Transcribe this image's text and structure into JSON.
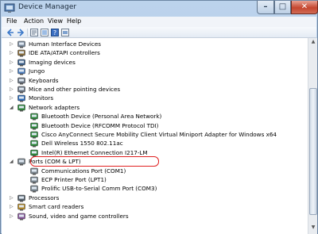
{
  "window": {
    "title": "Device Manager"
  },
  "menu": [
    "File",
    "Action",
    "View",
    "Help"
  ],
  "tree": [
    {
      "label": "Human Interface Devices",
      "expanded": false,
      "icon": "hid-icon"
    },
    {
      "label": "IDE ATA/ATAPI controllers",
      "expanded": false,
      "icon": "ide-icon"
    },
    {
      "label": "Imaging devices",
      "expanded": false,
      "icon": "camera-icon"
    },
    {
      "label": "Jungo",
      "expanded": false,
      "icon": "jungo-icon"
    },
    {
      "label": "Keyboards",
      "expanded": false,
      "icon": "keyboard-icon"
    },
    {
      "label": "Mice and other pointing devices",
      "expanded": false,
      "icon": "mouse-icon"
    },
    {
      "label": "Monitors",
      "expanded": false,
      "icon": "monitor-icon"
    },
    {
      "label": "Network adapters",
      "expanded": true,
      "icon": "network-icon"
    },
    {
      "label": "Bluetooth Device (Personal Area Network)",
      "child": true,
      "icon": "network-adapter-icon"
    },
    {
      "label": "Bluetooth Device (RFCOMM Protocol TDI)",
      "child": true,
      "icon": "network-adapter-icon"
    },
    {
      "label": "Cisco AnyConnect Secure Mobility Client Virtual Miniport Adapter for Windows x64",
      "child": true,
      "icon": "network-adapter-icon"
    },
    {
      "label": "Dell Wireless 1550 802.11ac",
      "child": true,
      "icon": "network-adapter-icon"
    },
    {
      "label": "Intel(R) Ethernet Connection I217-LM",
      "child": true,
      "icon": "network-adapter-icon"
    },
    {
      "label": "Ports (COM & LPT)",
      "expanded": true,
      "icon": "port-icon"
    },
    {
      "label": "Communications Port (COM1)",
      "child": true,
      "icon": "port-icon"
    },
    {
      "label": "ECP Printer Port (LPT1)",
      "child": true,
      "icon": "port-icon"
    },
    {
      "label": "Prolific USB-to-Serial Comm Port (COM3)",
      "child": true,
      "icon": "port-icon"
    },
    {
      "label": "Processors",
      "expanded": false,
      "icon": "processor-icon"
    },
    {
      "label": "Smart card readers",
      "expanded": false,
      "icon": "smartcard-icon"
    },
    {
      "label": "Sound, video and game controllers",
      "expanded": false,
      "icon": "sound-icon"
    }
  ],
  "highlight_color": "#e02020"
}
